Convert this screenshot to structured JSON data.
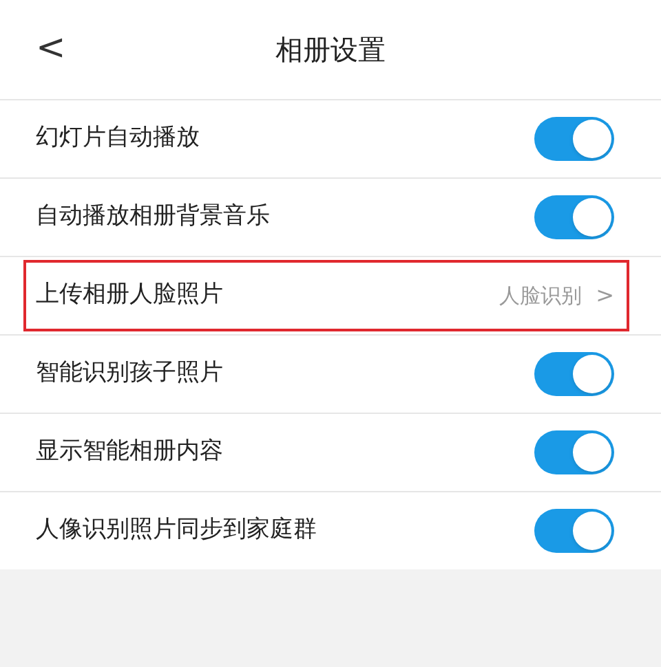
{
  "header": {
    "back": "<",
    "title": "相册设置"
  },
  "rows": [
    {
      "kind": "toggle",
      "label": "幻灯片自动播放",
      "on": true,
      "highlighted": false
    },
    {
      "kind": "toggle",
      "label": "自动播放相册背景音乐",
      "on": true,
      "highlighted": false
    },
    {
      "kind": "link",
      "label": "上传相册人脸照片",
      "value": "人脸识别",
      "chevron": ">",
      "highlighted": true
    },
    {
      "kind": "toggle",
      "label": "智能识别孩子照片",
      "on": true,
      "highlighted": false
    },
    {
      "kind": "toggle",
      "label": "显示智能相册内容",
      "on": true,
      "highlighted": false
    },
    {
      "kind": "toggle",
      "label": "人像识别照片同步到家庭群",
      "on": true,
      "highlighted": false
    }
  ]
}
